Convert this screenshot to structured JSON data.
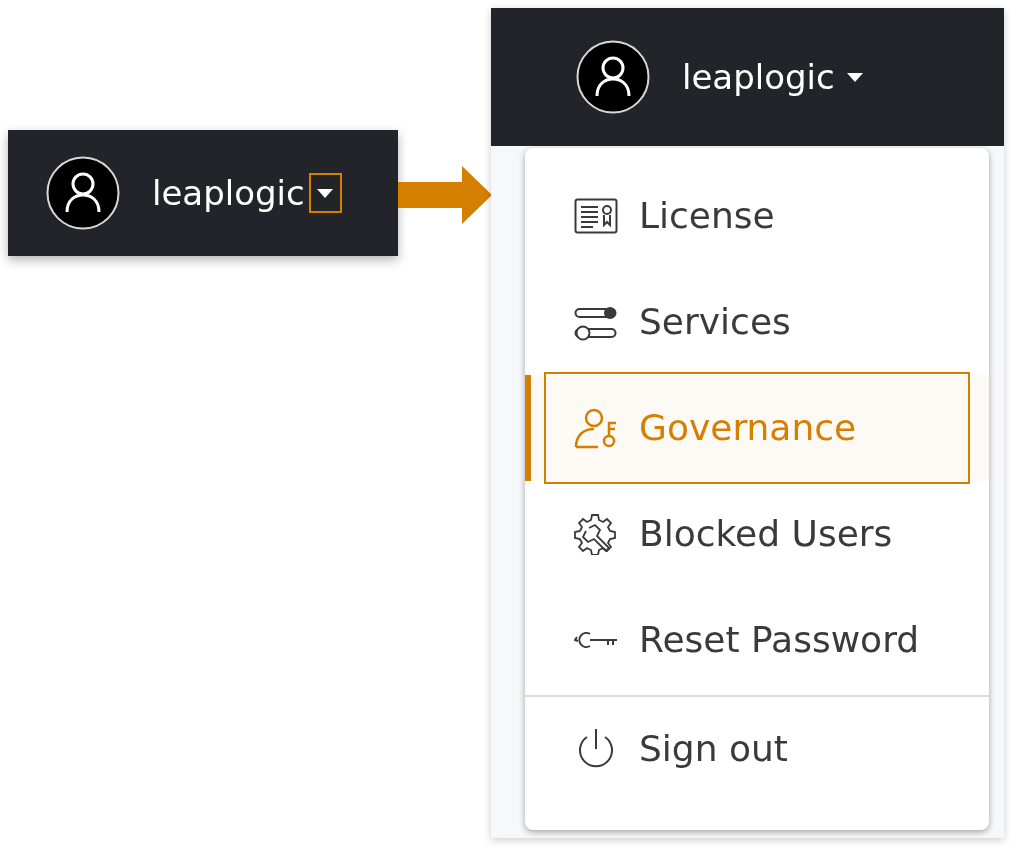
{
  "collapsed_header": {
    "username": "leaplogic",
    "caret_highlighted": true
  },
  "expanded_header": {
    "username": "leaplogic"
  },
  "menu": {
    "items": [
      {
        "label": "License",
        "selected": false
      },
      {
        "label": "Services",
        "selected": false
      },
      {
        "label": "Governance",
        "selected": true
      },
      {
        "label": "Blocked Users",
        "selected": false
      },
      {
        "label": "Reset Password",
        "selected": false
      }
    ],
    "footer_items": [
      {
        "label": "Sign out"
      }
    ]
  }
}
